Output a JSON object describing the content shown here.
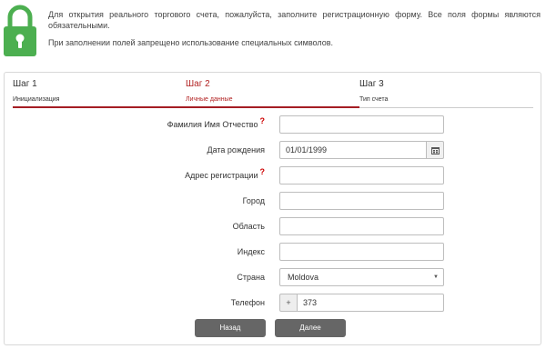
{
  "intro": {
    "line1": "Для открытия реального торгового счета, пожалуйста, заполните регистрационную форму. Все поля формы являются обязательными.",
    "line2": "При заполнении полей запрещено использование специальных символов."
  },
  "steps": [
    {
      "title": "Шаг 1",
      "subtitle": "Инициализация",
      "active": false
    },
    {
      "title": "Шаг 2",
      "subtitle": "Личные данные",
      "active": true
    },
    {
      "title": "Шаг 3",
      "subtitle": "Тип счета",
      "active": false
    }
  ],
  "form": {
    "full_name": {
      "label": "Фамилия Имя Отчество",
      "help": "?",
      "value": ""
    },
    "birth_date": {
      "label": "Дата рождения",
      "value": "01/01/1999"
    },
    "address": {
      "label": "Адрес регистрации",
      "help": "?",
      "value": ""
    },
    "city": {
      "label": "Город",
      "value": ""
    },
    "region": {
      "label": "Область",
      "value": ""
    },
    "zip": {
      "label": "Индекс",
      "value": ""
    },
    "country": {
      "label": "Страна",
      "value": "Moldova"
    },
    "phone": {
      "label": "Телефон",
      "prefix": "+",
      "value": "373"
    }
  },
  "buttons": {
    "back": "Назад",
    "next": "Далее"
  },
  "colors": {
    "lock": "#4caf50",
    "active_step": "#b22222",
    "progress": "#a51d24",
    "button": "#666666"
  },
  "icons": {
    "lock": "lock-icon",
    "calendar": "calendar-icon",
    "dropdown": "chevron-down-icon"
  }
}
